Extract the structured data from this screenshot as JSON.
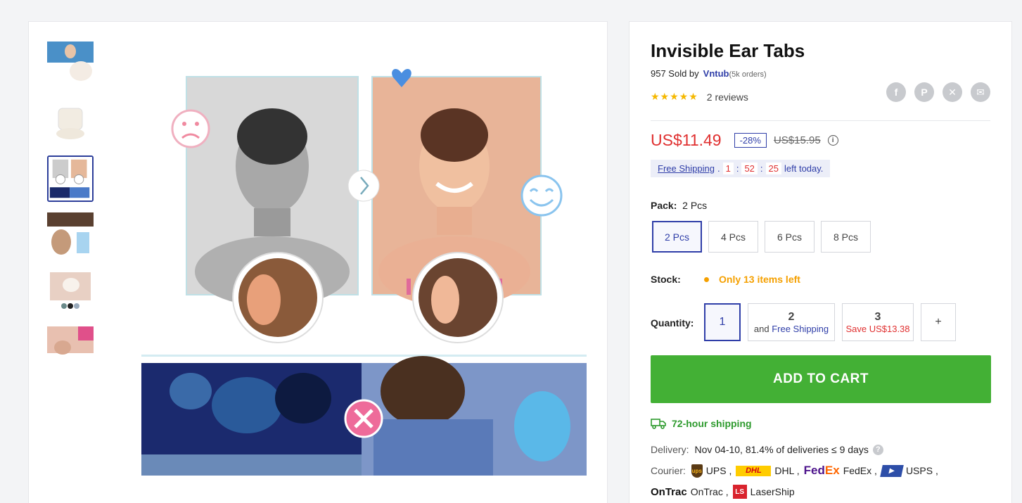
{
  "product": {
    "title": "Invisible Ear Tabs",
    "sold_count": "957 Sold by",
    "seller": "Vntub",
    "seller_orders": "(5k orders)",
    "rating": 4.5,
    "stars_display": "★★★★★",
    "reviews": "2 reviews"
  },
  "share": [
    {
      "icon": "facebook-icon",
      "glyph": "f"
    },
    {
      "icon": "pinterest-icon",
      "glyph": "P"
    },
    {
      "icon": "x-icon",
      "glyph": "✕"
    },
    {
      "icon": "email-icon",
      "glyph": "✉"
    }
  ],
  "price": {
    "current": "US$11.49",
    "discount": "-28%",
    "original": "US$15.95",
    "info_glyph": "i"
  },
  "shipping_bar": {
    "label": "Free Shipping",
    "dot": ".",
    "hours": "1",
    "minutes": "52",
    "seconds": "25",
    "sep": ":",
    "suffix": "left today."
  },
  "pack": {
    "label": "Pack:",
    "selected": "2 Pcs",
    "options": [
      "2 Pcs",
      "4 Pcs",
      "6 Pcs",
      "8 Pcs"
    ]
  },
  "stock": {
    "label": "Stock:",
    "text": "Only 13 items left"
  },
  "quantity": {
    "label": "Quantity:",
    "opt1": "1",
    "opt2_num": "2",
    "opt2_and": "and",
    "opt2_sub": "Free Shipping",
    "opt3_num": "3",
    "opt3_sub": "Save US$13.38",
    "plus": "+"
  },
  "cart": {
    "label": "ADD TO CART"
  },
  "shipping_info": {
    "hour_shipping": "72-hour shipping",
    "delivery_label": "Delivery:",
    "delivery_value": "Nov 04-10, 81.4% of deliveries ≤ 9 days",
    "help_glyph": "?",
    "courier_label": "Courier:",
    "carriers": [
      {
        "logo": "ups",
        "logo_text": "ups",
        "name": "UPS ,"
      },
      {
        "logo": "dhl",
        "logo_text": "DHL",
        "name": "DHL ,"
      },
      {
        "logo": "fedex",
        "logo_text": "FedEx",
        "name": "FedEx ,"
      },
      {
        "logo": "usps",
        "logo_text": "USPS",
        "name": "USPS ,"
      },
      {
        "logo": "ontrac",
        "logo_text": "OnTrac",
        "name": "OnTrac ,"
      },
      {
        "logo": "lasership",
        "logo_text": "LS",
        "name": "LaserShip"
      }
    ]
  },
  "colors": {
    "accent": "#2f3ea8",
    "price_red": "#e03030",
    "cart_green": "#43b035",
    "stock_orange": "#f5a000"
  }
}
